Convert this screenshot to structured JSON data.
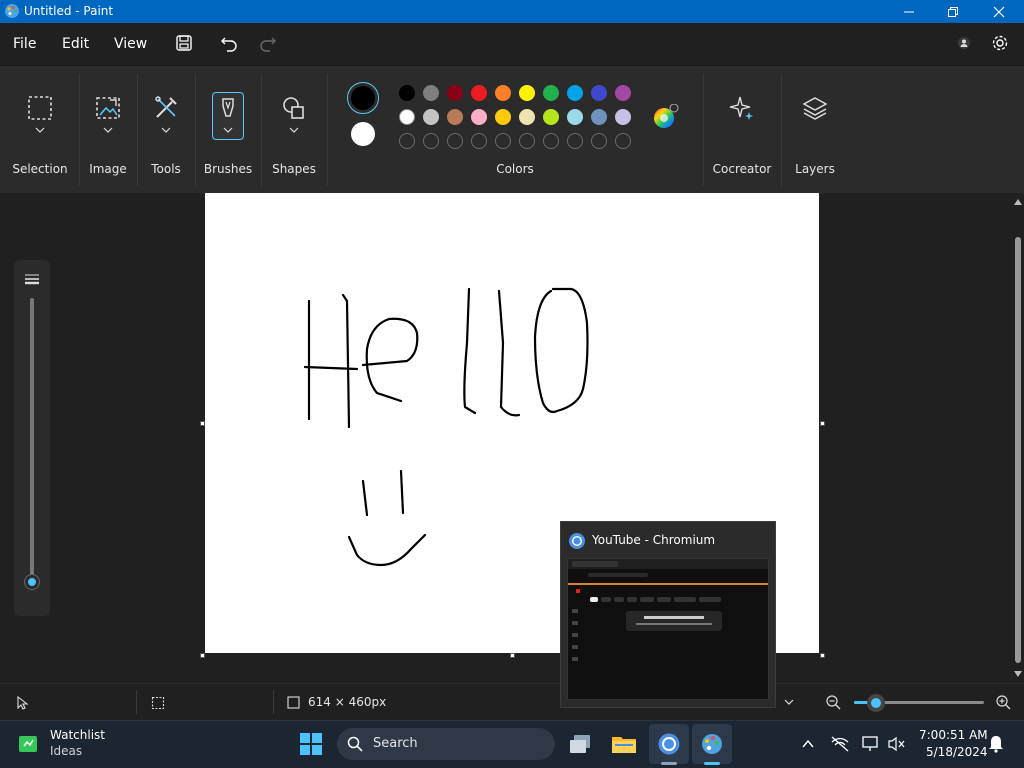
{
  "window": {
    "title": "Untitled - Paint"
  },
  "menu": {
    "file": "File",
    "edit": "Edit",
    "view": "View"
  },
  "ribbon": {
    "groups": {
      "selection": "Selection",
      "image": "Image",
      "tools": "Tools",
      "brushes": "Brushes",
      "shapes": "Shapes",
      "colors": "Colors",
      "cocreator": "Cocreator",
      "layers": "Layers"
    },
    "primary_color": "#000000",
    "secondary_color": "#ffffff",
    "palette_row1": [
      "#000000",
      "#7f7f7f",
      "#880015",
      "#ed1c24",
      "#ff7f27",
      "#fff200",
      "#22b14c",
      "#00a2e8",
      "#3f48cc",
      "#a349a4"
    ],
    "palette_row2": [
      "#ffffff",
      "#c3c3c3",
      "#b97a57",
      "#ffaec9",
      "#ffc90e",
      "#efe4b0",
      "#b5e61d",
      "#99d9ea",
      "#7092be",
      "#c8bfe7"
    ]
  },
  "status": {
    "canvas_size": "614 × 460px"
  },
  "popup": {
    "title": "YouTube - Chromium"
  },
  "taskbar": {
    "widget_title": "Watchlist",
    "widget_subtitle": "Ideas",
    "search_placeholder": "Search",
    "time": "7:00:51 AM",
    "date": "5/18/2024"
  },
  "brush_size_level": 0.0
}
